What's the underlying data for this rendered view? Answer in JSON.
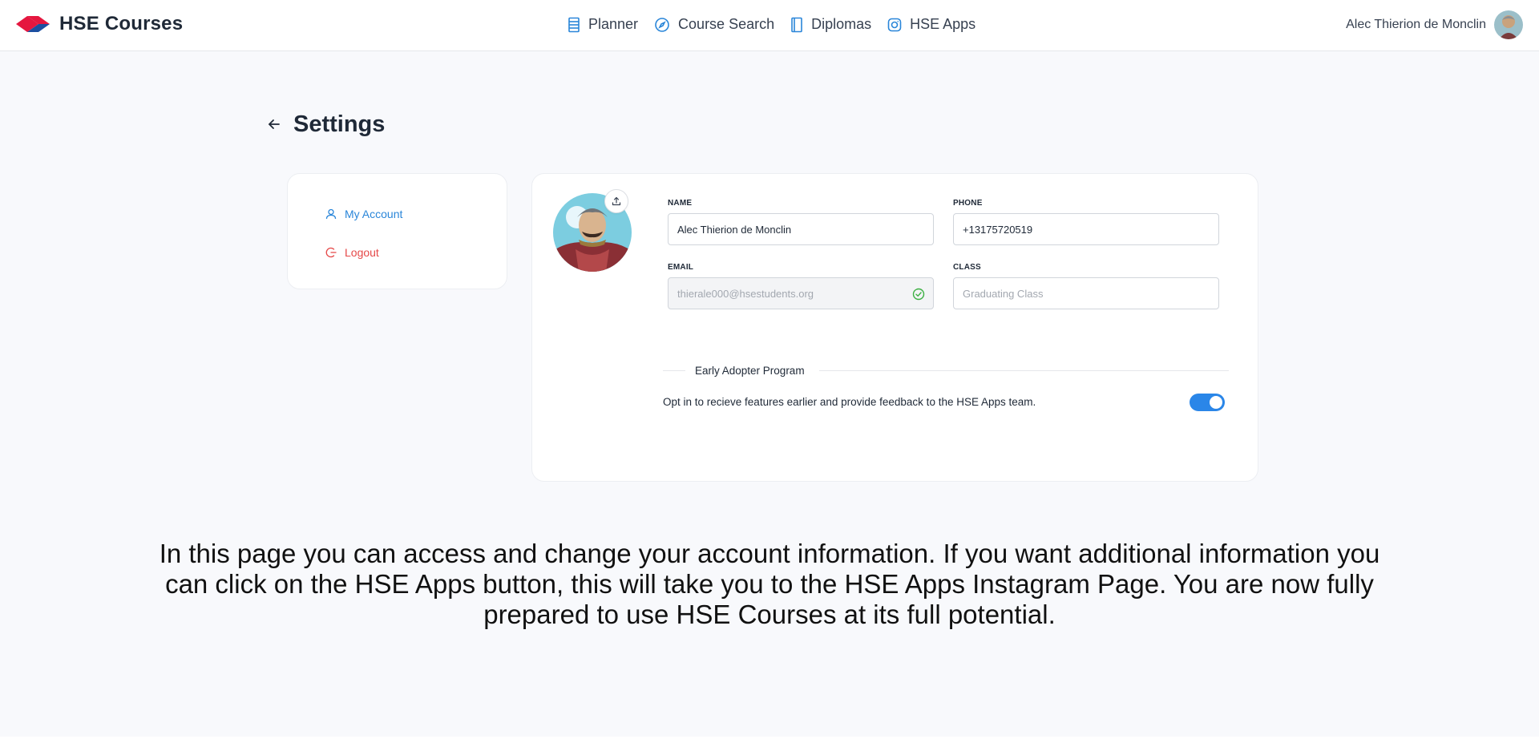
{
  "header": {
    "brand": "HSE Courses",
    "nav": [
      {
        "label": "Planner",
        "icon": "planner-icon"
      },
      {
        "label": "Course Search",
        "icon": "compass-icon"
      },
      {
        "label": "Diplomas",
        "icon": "book-icon"
      },
      {
        "label": "HSE Apps",
        "icon": "instagram-icon"
      }
    ],
    "user_name": "Alec Thierion de Monclin"
  },
  "page": {
    "title": "Settings"
  },
  "sidebar": {
    "items": [
      {
        "label": "My Account",
        "icon": "user-icon",
        "color": "#2a86d9"
      },
      {
        "label": "Logout",
        "icon": "logout-icon",
        "color": "#e54848"
      }
    ]
  },
  "form": {
    "name_label": "NAME",
    "name_value": "Alec Thierion de Monclin",
    "phone_label": "PHONE",
    "phone_value": "+13175720519",
    "email_label": "EMAIL",
    "email_value": "thierale000@hsestudents.org",
    "class_label": "CLASS",
    "class_placeholder": "Graduating Class"
  },
  "early_adopter": {
    "heading": "Early Adopter Program",
    "description": "Opt in to recieve features earlier and provide feedback to the HSE Apps team.",
    "enabled": true
  },
  "caption": "In this page you can access and change your account information. If you want additional information you can click on the HSE Apps button, this will take you to the HSE Apps Instagram Page. You are now fully prepared to use HSE Courses at its full potential.",
  "colors": {
    "accent": "#2a86e8",
    "danger": "#e54848",
    "brand_red": "#e5173f",
    "brand_blue": "#1c4fa0",
    "background": "#f8f9fc"
  }
}
